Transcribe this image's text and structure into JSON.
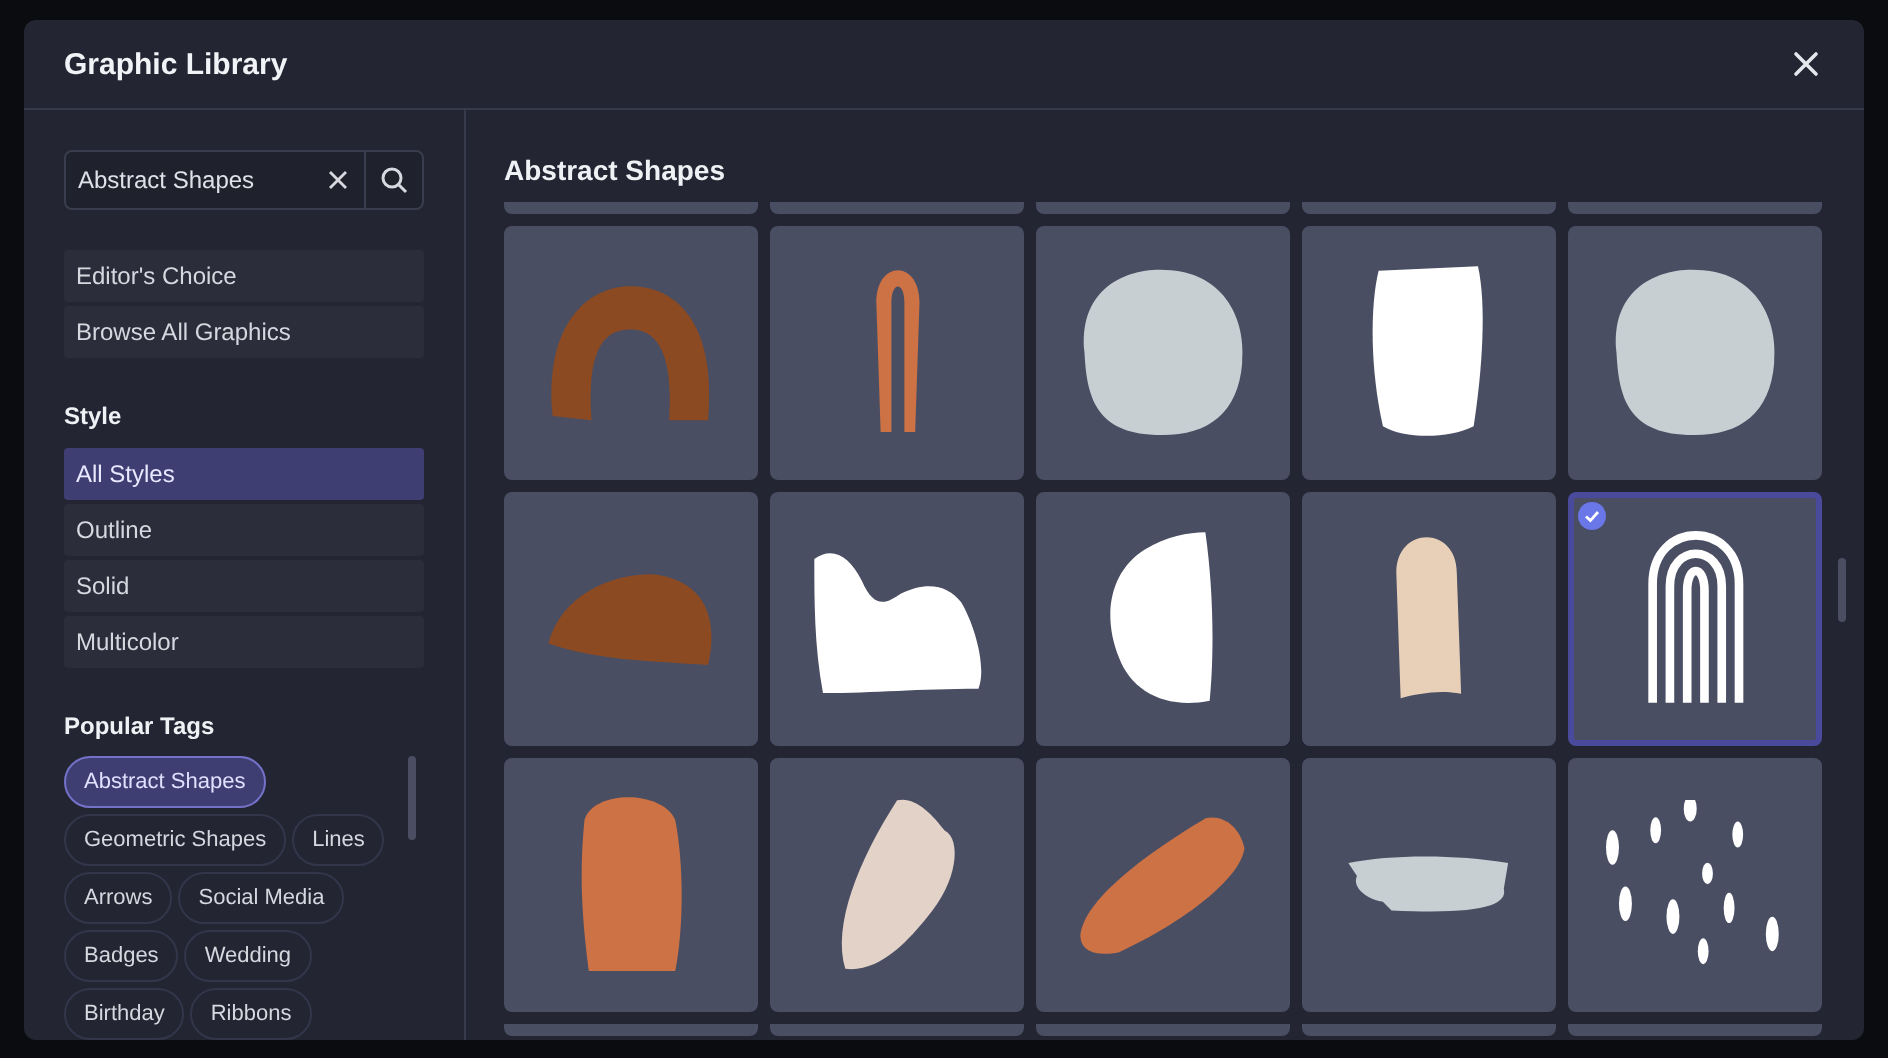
{
  "window": {
    "title": "Graphic Library"
  },
  "search": {
    "value": "Abstract Shapes"
  },
  "collections": [
    {
      "label": "Editor's Choice"
    },
    {
      "label": "Browse All Graphics"
    }
  ],
  "style": {
    "heading": "Style",
    "items": [
      {
        "label": "All Styles",
        "selected": true
      },
      {
        "label": "Outline",
        "selected": false
      },
      {
        "label": "Solid",
        "selected": false
      },
      {
        "label": "Multicolor",
        "selected": false
      }
    ]
  },
  "tags": {
    "heading": "Popular Tags",
    "items": [
      {
        "label": "Abstract Shapes",
        "selected": true
      },
      {
        "label": "Geometric Shapes",
        "selected": false
      },
      {
        "label": "Lines",
        "selected": false
      },
      {
        "label": "Arrows",
        "selected": false
      },
      {
        "label": "Social Media",
        "selected": false
      },
      {
        "label": "Badges",
        "selected": false
      },
      {
        "label": "Wedding",
        "selected": false
      },
      {
        "label": "Birthday",
        "selected": false
      },
      {
        "label": "Ribbons",
        "selected": false
      }
    ]
  },
  "gallery": {
    "title": "Abstract Shapes",
    "graphics": [
      {
        "kind": "arch",
        "color": "#8b4a22",
        "selected": false
      },
      {
        "kind": "thin-arch",
        "color": "#cc7245",
        "selected": false
      },
      {
        "kind": "blob",
        "color": "#c8cfd3",
        "selected": false
      },
      {
        "kind": "cup",
        "color": "#ffffff",
        "selected": false
      },
      {
        "kind": "blob",
        "color": "#c8cfd3",
        "selected": false
      },
      {
        "kind": "dome",
        "color": "#8b4a22",
        "selected": false
      },
      {
        "kind": "wave",
        "color": "#ffffff",
        "selected": false
      },
      {
        "kind": "half-circle",
        "color": "#ffffff",
        "selected": false
      },
      {
        "kind": "finger",
        "color": "#e8d0b8",
        "selected": false
      },
      {
        "kind": "rainbow-lines",
        "color": "#ffffff",
        "selected": true
      },
      {
        "kind": "pill",
        "color": "#cc7245",
        "selected": false
      },
      {
        "kind": "brush",
        "color": "#e2d2c8",
        "selected": false
      },
      {
        "kind": "brush-diagonal",
        "color": "#cc7245",
        "selected": false
      },
      {
        "kind": "smear",
        "color": "#c8cfd3",
        "selected": false
      },
      {
        "kind": "dots",
        "color": "#ffffff",
        "selected": false
      }
    ]
  }
}
